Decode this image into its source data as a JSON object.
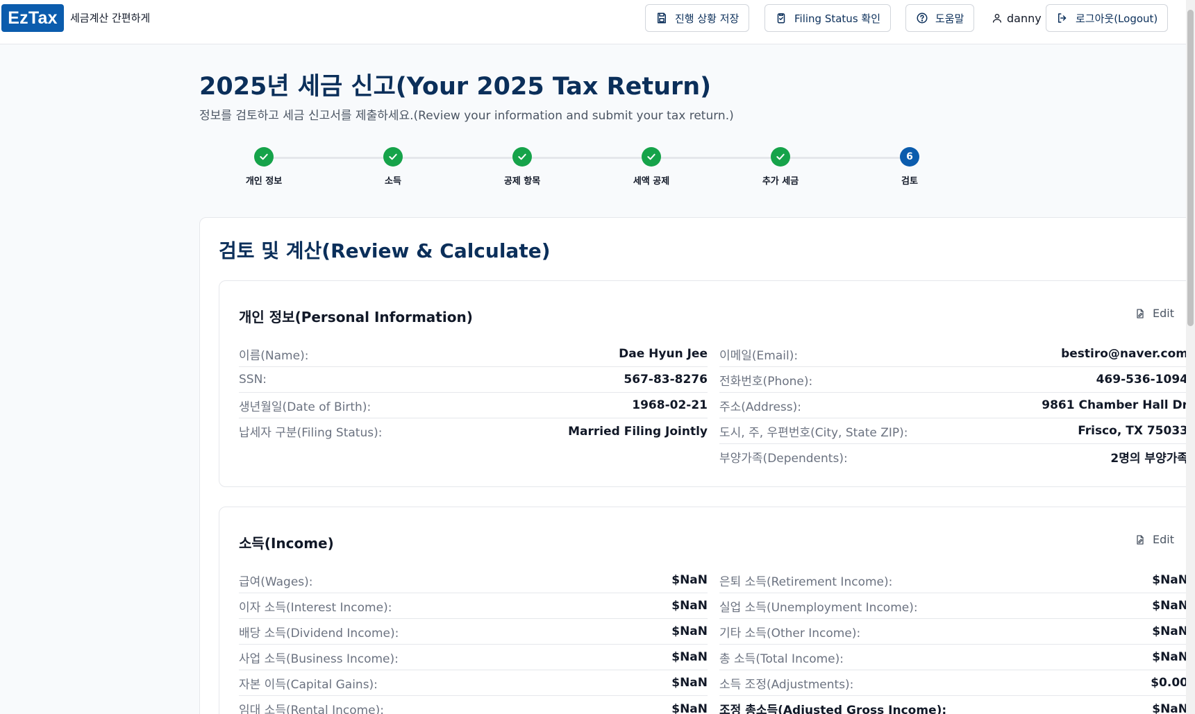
{
  "header": {
    "logo": "EzTax",
    "tagline": "세금계산 간편하게",
    "save_label": "진행 상황 저장",
    "filing_status_label": "Filing Status 확인",
    "help_label": "도움말",
    "username": "danny",
    "logout_label": "로그아웃(Logout)"
  },
  "page": {
    "title": "2025년 세금 신고(Your 2025 Tax Return)",
    "subtitle": "정보를 검토하고 세금 신고서를 제출하세요.(Review your information and submit your tax return.)"
  },
  "steps": [
    {
      "label": "개인 정보",
      "status": "complete"
    },
    {
      "label": "소득",
      "status": "complete"
    },
    {
      "label": "공제 항목",
      "status": "complete"
    },
    {
      "label": "세액 공제",
      "status": "complete"
    },
    {
      "label": "추가 세금",
      "status": "complete"
    },
    {
      "label": "검토",
      "number": "6",
      "status": "current"
    }
  ],
  "review": {
    "title": "검토 및 계산(Review & Calculate)",
    "edit_label": "Edit",
    "personal": {
      "title": "개인 정보(Personal Information)",
      "left": [
        {
          "label": "이름(Name):",
          "value": "Dae Hyun Jee"
        },
        {
          "label": "SSN:",
          "value": "567-83-8276"
        },
        {
          "label": "생년월일(Date of Birth):",
          "value": "1968-02-21"
        },
        {
          "label": "납세자 구분(Filing Status):",
          "value": "Married Filing Jointly"
        }
      ],
      "right": [
        {
          "label": "이메일(Email):",
          "value": "bestiro@naver.com"
        },
        {
          "label": "전화번호(Phone):",
          "value": "469-536-1094"
        },
        {
          "label": "주소(Address):",
          "value": "9861 Chamber Hall Dr"
        },
        {
          "label": "도시, 주, 우편번호(City, State ZIP):",
          "value": "Frisco, TX 75033"
        },
        {
          "label": "부양가족(Dependents):",
          "value": "2명의 부양가족"
        }
      ]
    },
    "income": {
      "title": "소득(Income)",
      "left": [
        {
          "label": "급여(Wages):",
          "value": "$NaN"
        },
        {
          "label": "이자 소득(Interest Income):",
          "value": "$NaN"
        },
        {
          "label": "배당 소득(Dividend Income):",
          "value": "$NaN"
        },
        {
          "label": "사업 소득(Business Income):",
          "value": "$NaN"
        },
        {
          "label": "자본 이득(Capital Gains):",
          "value": "$NaN"
        },
        {
          "label": "임대 소득(Rental Income):",
          "value": "$NaN"
        }
      ],
      "right": [
        {
          "label": "은퇴 소득(Retirement Income):",
          "value": "$NaN"
        },
        {
          "label": "실업 소득(Unemployment Income):",
          "value": "$NaN"
        },
        {
          "label": "기타 소득(Other Income):",
          "value": "$NaN"
        },
        {
          "label": "총 소득(Total Income):",
          "value": "$NaN"
        },
        {
          "label": "소득 조정(Adjustments):",
          "value": "$0.00"
        },
        {
          "label": "조정 총소득(Adjusted Gross Income):",
          "value": "$NaN"
        }
      ]
    }
  }
}
